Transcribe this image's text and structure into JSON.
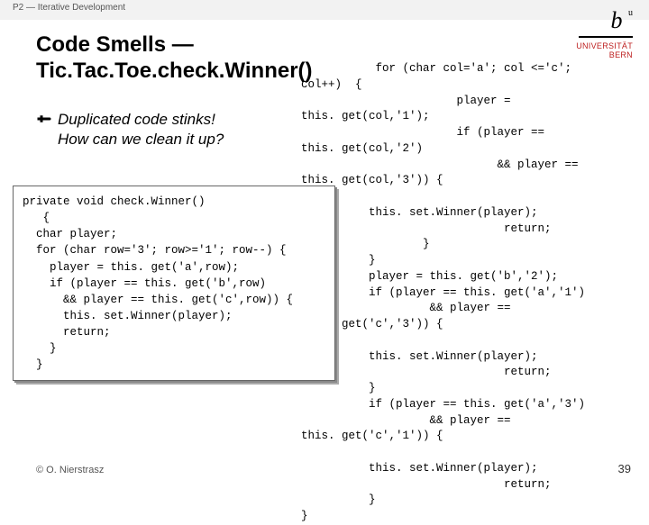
{
  "header": {
    "breadcrumb": "P2 — Iterative Development"
  },
  "logo": {
    "letter": "b",
    "superscript": "u",
    "university_line": "UNIVERSITÄT",
    "city_line": "BERN"
  },
  "title": {
    "text": "Code Smells — Tic.Tac.Toe.check.Winner()"
  },
  "bullet": {
    "line1": "Duplicated code stinks!",
    "line2": "How can we clean it up?"
  },
  "code_left": "private void check.Winner()\n   {\n  char player;\n  for (char row='3'; row>='1'; row--) {\n    player = this. get('a',row);\n    if (player == this. get('b',row)\n      && player == this. get('c',row)) {\n      this. set.Winner(player);\n      return;\n    }\n  }",
  "code_right": "           for (char col='a'; col <='c';\ncol++)  {\n                       player =\nthis. get(col,'1');\n                       if (player ==\nthis. get(col,'2')\n                             && player ==\nthis. get(col,'3')) {\n\n          this. set.Winner(player);\n                              return;\n                  }\n          }\n          player = this. get('b','2');\n          if (player == this. get('a','1')\n                   && player ==\nthis. get('c','3')) {\n\n          this. set.Winner(player);\n                              return;\n          }\n          if (player == this. get('a','3')\n                   && player ==\nthis. get('c','1')) {\n\n          this. set.Winner(player);\n                              return;\n          }\n}",
  "footer": {
    "copyright": "© O. Nierstrasz"
  },
  "pagenum": "39"
}
